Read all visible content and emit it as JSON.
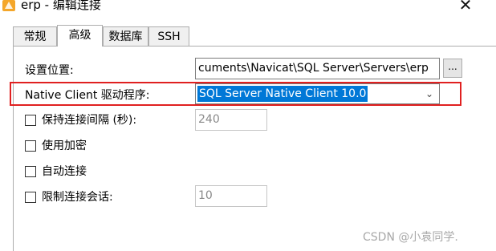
{
  "window": {
    "title": "erp - 编辑连接",
    "close_glyph": "✕",
    "app_icon": "navicat-icon"
  },
  "tabs": [
    {
      "label": "常规",
      "active": false
    },
    {
      "label": "高级",
      "active": true
    },
    {
      "label": "数据库",
      "active": false
    },
    {
      "label": "SSH",
      "active": false
    }
  ],
  "advanced": {
    "settings_location_label": "设置位置:",
    "settings_location_value": "cuments\\Navicat\\SQL Server\\Servers\\erp",
    "browse_label": "...",
    "driver_label": "Native Client 驱动程序:",
    "driver_value": "SQL Server Native Client 10.0",
    "keepalive_label": "保持连接间隔 (秒):",
    "keepalive_value": "240",
    "keepalive_checked": false,
    "encryption_label": "使用加密",
    "encryption_checked": false,
    "auto_connect_label": "自动连接",
    "auto_connect_checked": false,
    "limit_sessions_label": "限制连接会话:",
    "limit_sessions_value": "10",
    "limit_sessions_checked": false
  },
  "watermark": "CSDN @小袁同学.",
  "colors": {
    "highlight": "#e02020",
    "selection": "#0078d7"
  }
}
